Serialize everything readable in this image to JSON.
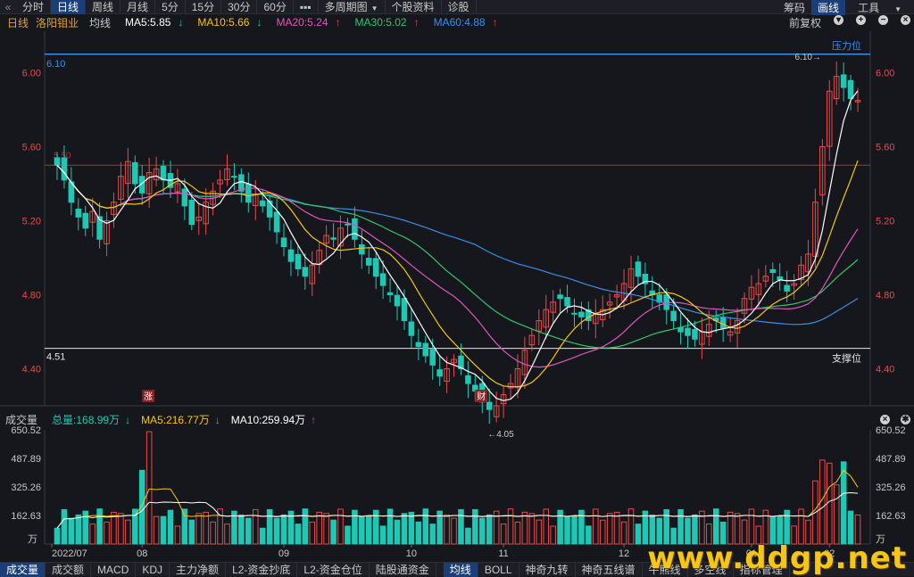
{
  "toolbar": {
    "back_icon": "double-chevron-left-icon",
    "periods": [
      "分时",
      "日线",
      "周线",
      "月线",
      "5分",
      "15分",
      "30分",
      "60分"
    ],
    "active_period": "日线",
    "more_label": "▪▪▪",
    "multi_period": "多周期图",
    "stock_info": "个股资料",
    "diagnose": "诊股",
    "right": [
      "筹码",
      "画线",
      "工具"
    ]
  },
  "legend": {
    "period": "日线",
    "stock": "洛阳钼业",
    "ma_label": "均线",
    "ma5": "MA5:5.85",
    "ma10": "MA10:5.66",
    "ma20": "MA20:5.24",
    "ma30": "MA30:5.02",
    "ma60": "MA60:4.88",
    "adjust": "前复权",
    "colors": {
      "ma5": "#ffffff",
      "ma10": "#f5c518",
      "ma20": "#e055c0",
      "ma30": "#34c46a",
      "ma60": "#3a8eea",
      "up": "#e84a4a",
      "down": "#1ec8b4"
    }
  },
  "chart_data": {
    "type": "candlestick",
    "y_ticks": [
      "6.00",
      "5.60",
      "5.20",
      "4.80",
      "4.40"
    ],
    "ylim": [
      4.2,
      6.2
    ],
    "months": [
      "2022/07",
      "08",
      "09",
      "10",
      "11",
      "12",
      "01",
      "02"
    ],
    "resistance_label": "压力位",
    "resistance_value": "6.10",
    "resistance_high": "6.10",
    "support_label": "支撑位",
    "support_value": "4.51",
    "low_value": "4.05",
    "mid_line_value": "5.50",
    "marker_up": "涨",
    "marker_fin": "财",
    "closes": [
      5.5,
      5.42,
      5.3,
      5.22,
      5.16,
      5.25,
      5.1,
      5.2,
      5.3,
      5.44,
      5.52,
      5.4,
      5.35,
      5.46,
      5.48,
      5.42,
      5.38,
      5.4,
      5.28,
      5.18,
      5.22,
      5.3,
      5.36,
      5.42,
      5.48,
      5.44,
      5.36,
      5.3,
      5.34,
      5.28,
      5.22,
      5.14,
      5.06,
      4.98,
      4.94,
      4.9,
      4.96,
      5.04,
      5.12,
      5.1,
      5.16,
      5.18,
      5.1,
      5.02,
      4.96,
      4.9,
      4.85,
      4.8,
      4.74,
      4.66,
      4.58,
      4.52,
      4.47,
      4.42,
      4.36,
      4.4,
      4.45,
      4.4,
      4.32,
      4.28,
      4.22,
      4.18,
      4.2,
      4.26,
      4.32,
      4.4,
      4.5,
      4.58,
      4.66,
      4.72,
      4.76,
      4.78,
      4.74,
      4.7,
      4.68,
      4.66,
      4.7,
      4.72,
      4.76,
      4.8,
      4.86,
      4.94,
      4.9,
      4.86,
      4.8,
      4.76,
      4.72,
      4.66,
      4.6,
      4.58,
      4.56,
      4.6,
      4.64,
      4.66,
      4.62,
      4.6,
      4.66,
      4.78,
      4.84,
      4.86,
      4.9,
      4.92,
      4.88,
      4.82,
      4.86,
      4.96,
      5.02,
      5.3,
      5.6,
      5.9,
      5.98,
      5.92,
      5.86,
      5.85
    ]
  },
  "volume": {
    "label": "成交量",
    "total": "总量:168.99万",
    "ma5": "MA5:216.77万",
    "ma10": "MA10:259.94万",
    "y_ticks": [
      "650.52",
      "487.89",
      "325.26",
      "162.63"
    ],
    "unit": "万",
    "vmax": 650.52
  },
  "bottom_tabs": [
    "成交量",
    "成交额",
    "MACD",
    "KDJ",
    "主力净额",
    "L2-资金抄底",
    "L2-资金仓位",
    "陆股通资金",
    "均线",
    "BOLL",
    "神奇九转",
    "神奇五线谱",
    "牛熊线",
    "多空线",
    "指标管理"
  ],
  "active_bottom": [
    "成交量",
    "均线"
  ],
  "watermark": "www.ddgp.net"
}
